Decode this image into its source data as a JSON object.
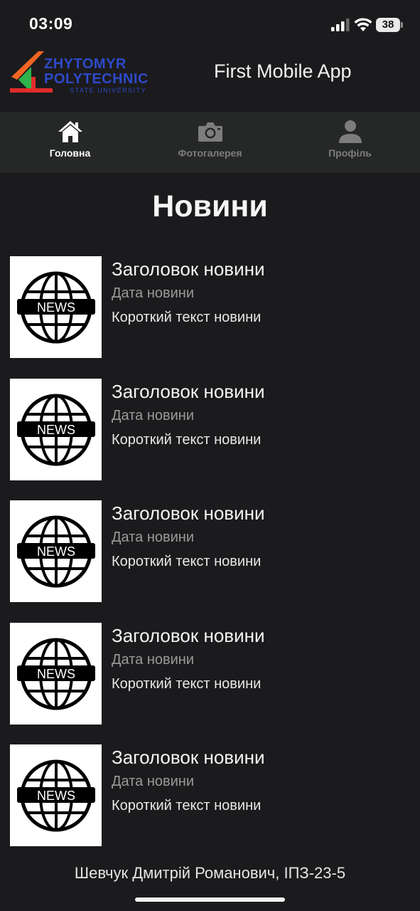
{
  "status_bar": {
    "time": "03:09",
    "battery": "38"
  },
  "header": {
    "logo": {
      "line1": "ZHYTOMYR",
      "line2": "POLYTECHNIC",
      "line3": "STATE UNIVERSITY"
    },
    "app_title": "First Mobile App"
  },
  "tabs": [
    {
      "label": "Головна",
      "icon": "home-icon",
      "active": true
    },
    {
      "label": "Фотогалерея",
      "icon": "camera-icon",
      "active": false
    },
    {
      "label": "Профіль",
      "icon": "profile-icon",
      "active": false
    }
  ],
  "page_title": "Новини",
  "news": [
    {
      "title": "Заголовок новини",
      "date": "Дата новини",
      "text": "Короткий текст новини",
      "thumb_label": "NEWS"
    },
    {
      "title": "Заголовок новини",
      "date": "Дата новини",
      "text": "Короткий текст новини",
      "thumb_label": "NEWS"
    },
    {
      "title": "Заголовок новини",
      "date": "Дата новини",
      "text": "Короткий текст новини",
      "thumb_label": "NEWS"
    },
    {
      "title": "Заголовок новини",
      "date": "Дата новини",
      "text": "Короткий текст новини",
      "thumb_label": "NEWS"
    },
    {
      "title": "Заголовок новини",
      "date": "Дата новини",
      "text": "Короткий текст новини",
      "thumb_label": "NEWS"
    }
  ],
  "footer": {
    "text": "Шевчук Дмитрій Романович, ІПЗ-23-5"
  },
  "colors": {
    "background": "#1b1b1d",
    "tab_bar": "#262727",
    "logo_blue": "#2e49c9",
    "inactive_tab": "#7d7d7d"
  }
}
